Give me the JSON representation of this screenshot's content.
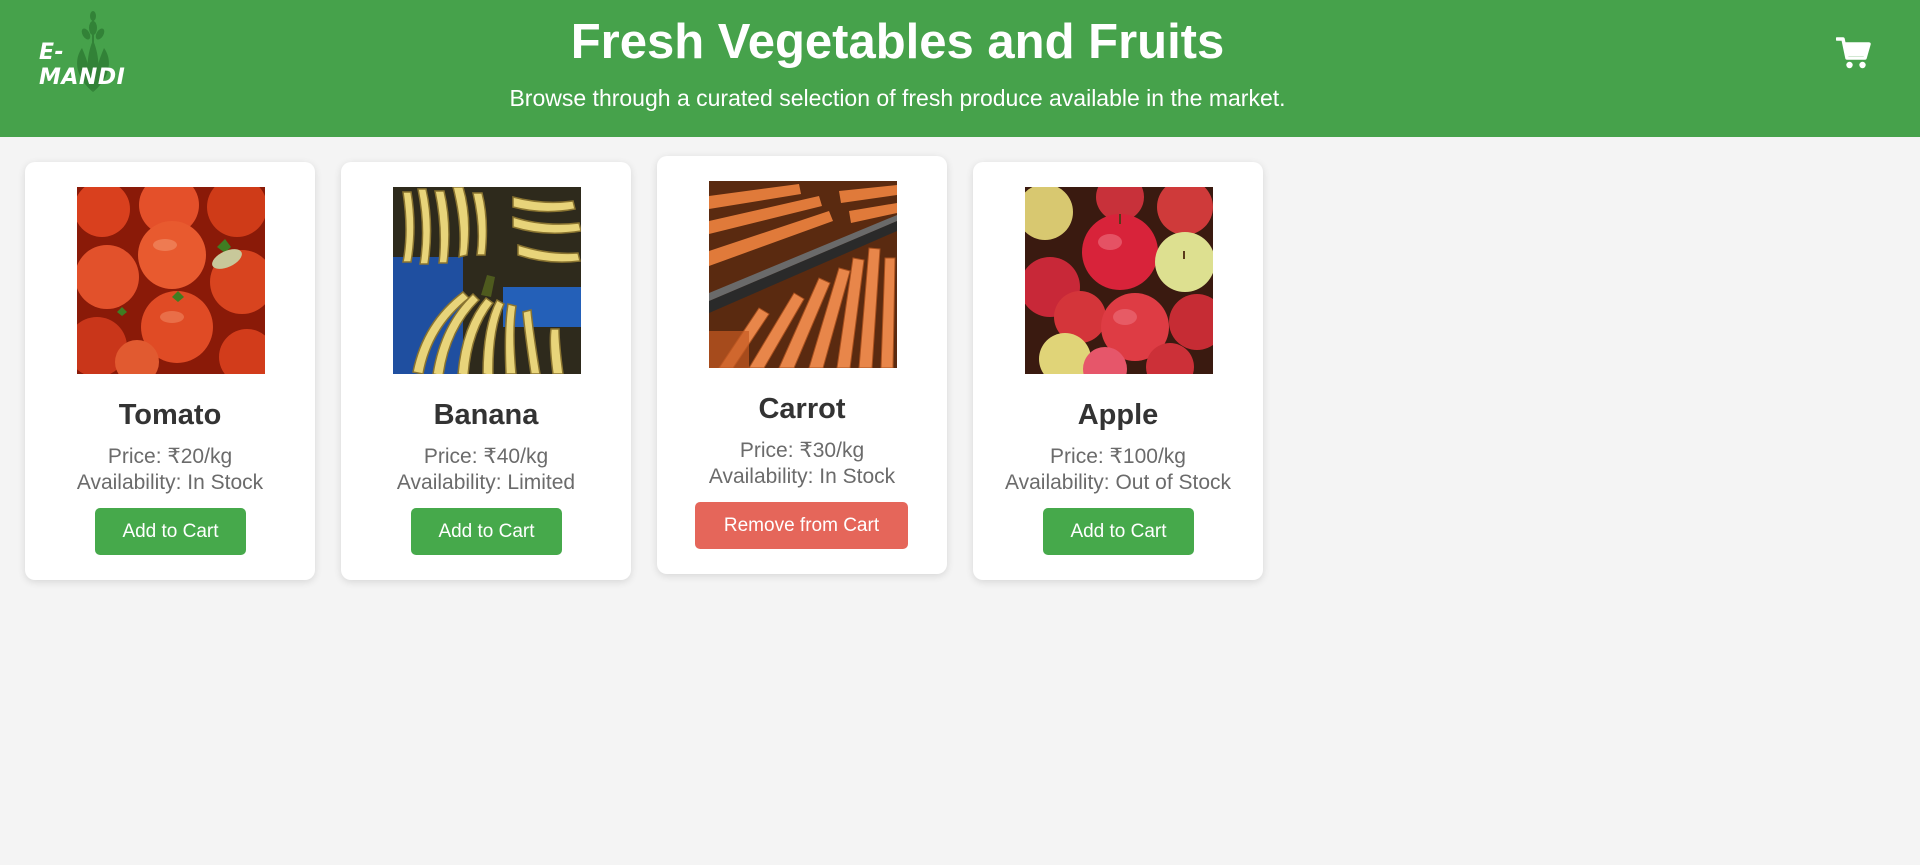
{
  "header": {
    "logo_text": "E-MANDI",
    "title": "Fresh Vegetables and Fruits",
    "subtitle": "Browse through a curated selection of fresh produce available in the market.",
    "cart_icon": "cart-icon"
  },
  "colors": {
    "header_bg": "#46a24b",
    "page_bg": "#f4f4f4",
    "add_button": "#46a94b",
    "remove_button": "#e5665a"
  },
  "products": [
    {
      "name": "Tomato",
      "price": "Price: ₹20/kg",
      "availability": "Availability: In Stock",
      "button": "Add to Cart",
      "image": "tomatoes-photo"
    },
    {
      "name": "Banana",
      "price": "Price: ₹40/kg",
      "availability": "Availability: Limited",
      "button": "Add to Cart",
      "image": "bananas-photo"
    },
    {
      "name": "Carrot",
      "price": "Price: ₹30/kg",
      "availability": "Availability: In Stock",
      "button": "Remove from Cart",
      "image": "carrots-photo"
    },
    {
      "name": "Apple",
      "price": "Price: ₹100/kg",
      "availability": "Availability: Out of Stock",
      "button": "Add to Cart",
      "image": "apples-photo"
    }
  ]
}
